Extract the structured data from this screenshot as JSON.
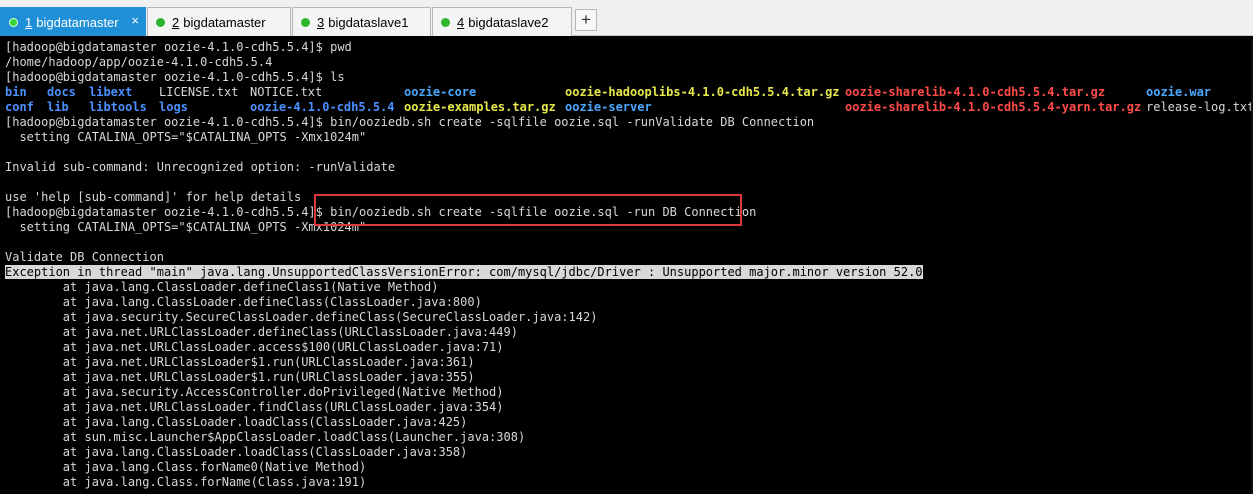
{
  "tabs": [
    {
      "num": "1",
      "label": "bigdatamaster",
      "active": true
    },
    {
      "num": "2",
      "label": "bigdatamaster",
      "active": false
    },
    {
      "num": "3",
      "label": "bigdataslave1",
      "active": false
    },
    {
      "num": "4",
      "label": "bigdataslave2",
      "active": false
    }
  ],
  "add_tab_label": "+",
  "close_label": "×",
  "terminal": {
    "lines_top": [
      "[hadoop@bigdatamaster oozie-4.1.0-cdh5.5.4]$ pwd",
      "/home/hadoop/app/oozie-4.1.0-cdh5.5.4",
      "[hadoop@bigdatamaster oozie-4.1.0-cdh5.5.4]$ ls"
    ],
    "ls_row1": {
      "bin": "bin",
      "docs": "docs",
      "libext": "libext",
      "license": "LICENSE.txt",
      "notice": "NOTICE.txt",
      "oozie_core": "oozie-core",
      "hadooplibs": "oozie-hadooplibs-4.1.0-cdh5.5.4.tar.gz",
      "sharelib": "oozie-sharelib-4.1.0-cdh5.5.4.tar.gz",
      "war": "oozie.war"
    },
    "ls_row2": {
      "conf": "conf",
      "lib": "lib",
      "libtools": "libtools",
      "logs": "logs",
      "oozie_dir": "oozie-4.1.0-cdh5.5.4",
      "examples": "oozie-examples.tar.gz",
      "server": "oozie-server",
      "sharelib_yarn": "oozie-sharelib-4.1.0-cdh5.5.4-yarn.tar.gz",
      "release_log": "release-log.txt"
    },
    "lines_middle": [
      "[hadoop@bigdatamaster oozie-4.1.0-cdh5.5.4]$ bin/ooziedb.sh create -sqlfile oozie.sql -runValidate DB Connection",
      "  setting CATALINA_OPTS=\"$CATALINA_OPTS -Xmx1024m\"",
      "",
      "Invalid sub-command: Unrecognized option: -runValidate",
      "",
      "use 'help [sub-command]' for help details",
      "[hadoop@bigdatamaster oozie-4.1.0-cdh5.5.4]$ bin/ooziedb.sh create -sqlfile oozie.sql -run DB Connection",
      "  setting CATALINA_OPTS=\"$CATALINA_OPTS -Xmx1024m\"",
      "",
      "Validate DB Connection"
    ],
    "exception_line": "Exception in thread \"main\" java.lang.UnsupportedClassVersionError: com/mysql/jdbc/Driver : Unsupported major.minor version 52.0",
    "stack": [
      "        at java.lang.ClassLoader.defineClass1(Native Method)",
      "        at java.lang.ClassLoader.defineClass(ClassLoader.java:800)",
      "        at java.security.SecureClassLoader.defineClass(SecureClassLoader.java:142)",
      "        at java.net.URLClassLoader.defineClass(URLClassLoader.java:449)",
      "        at java.net.URLClassLoader.access$100(URLClassLoader.java:71)",
      "        at java.net.URLClassLoader$1.run(URLClassLoader.java:361)",
      "        at java.net.URLClassLoader$1.run(URLClassLoader.java:355)",
      "        at java.security.AccessController.doPrivileged(Native Method)",
      "        at java.net.URLClassLoader.findClass(URLClassLoader.java:354)",
      "        at java.lang.ClassLoader.loadClass(ClassLoader.java:425)",
      "        at sun.misc.Launcher$AppClassLoader.loadClass(Launcher.java:308)",
      "        at java.lang.ClassLoader.loadClass(ClassLoader.java:358)",
      "        at java.lang.Class.forName0(Native Method)",
      "        at java.lang.Class.forName(Class.java:191)"
    ]
  },
  "colors": {
    "active_tab": "#1f8fd8",
    "status_dot": "#2db52d",
    "ls_dir": "#4a90ff",
    "ls_archive": "#e8e84a",
    "ls_archive_red": "#ff4a4a",
    "annotation_box": "#e0393b"
  }
}
